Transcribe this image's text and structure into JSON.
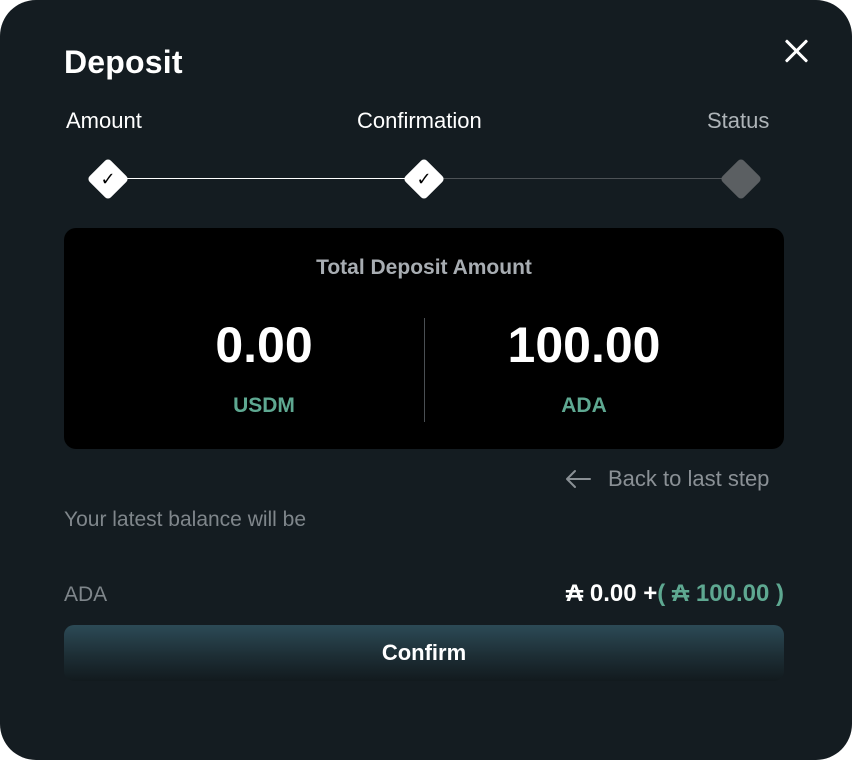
{
  "modal": {
    "title": "Deposit"
  },
  "steps": [
    {
      "label": "Amount",
      "state": "done"
    },
    {
      "label": "Confirmation",
      "state": "done"
    },
    {
      "label": "Status",
      "state": "pending"
    }
  ],
  "summary": {
    "title": "Total Deposit Amount",
    "left": {
      "amount": "0.00",
      "currency": "USDM"
    },
    "right": {
      "amount": "100.00",
      "currency": "ADA"
    }
  },
  "back_link": {
    "label": "Back to last step"
  },
  "balance": {
    "note": "Your latest balance will be",
    "asset": "ADA",
    "current": "₳ 0.00",
    "plus": "+",
    "addition": "( ₳ 100.00 )"
  },
  "actions": {
    "confirm_label": "Confirm"
  },
  "colors": {
    "background": "#141c21",
    "card": "#000000",
    "accent_green": "#5ea891",
    "muted_text": "#7f868b"
  },
  "icons": {
    "close": "close-icon",
    "check": "check-icon",
    "back": "arrow-left-icon"
  }
}
